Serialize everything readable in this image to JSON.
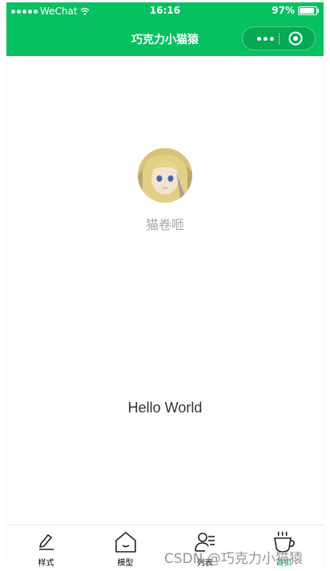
{
  "status_bar": {
    "carrier": "WeChat",
    "time": "16:16",
    "battery": "97%",
    "battery_level": 0.97
  },
  "nav": {
    "title": "巧克力小猫猿",
    "more_icon": "more-dots-icon",
    "close_icon": "target-close-icon"
  },
  "profile": {
    "nickname": "猫卷咂",
    "avatar_icon": "user-avatar"
  },
  "main": {
    "greeting": "Hello World"
  },
  "tabbar": {
    "items": [
      {
        "label": "样式",
        "icon": "edit-pen-icon",
        "active": false
      },
      {
        "label": "模型",
        "icon": "home-icon",
        "active": false
      },
      {
        "label": "列表",
        "icon": "contacts-list-icon",
        "active": false
      },
      {
        "label": "首页",
        "icon": "coffee-cup-icon",
        "active": true
      }
    ]
  },
  "watermark": "CSDN @巧克力小猫猿",
  "colors": {
    "brand": "#07c160",
    "active_tab": "#07c160",
    "nickname": "#a8a8a8"
  }
}
